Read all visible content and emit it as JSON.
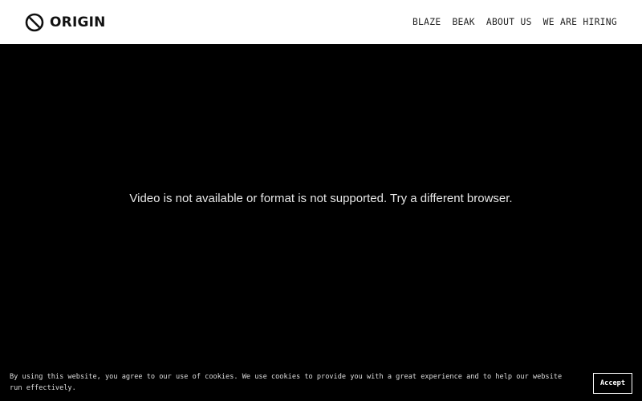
{
  "header": {
    "logo_text": "ORIGIN",
    "logo_icon": "origin-logo-icon",
    "nav": [
      {
        "label": "BLAZE"
      },
      {
        "label": "BEAK"
      },
      {
        "label": "ABOUT US"
      },
      {
        "label": "WE ARE HIRING"
      }
    ]
  },
  "video": {
    "message": "Video is not available or format is not supported. Try a different browser."
  },
  "cookie_banner": {
    "text": "By using this website, you agree to our use of cookies. We use cookies to provide you with a great experience and to help our website run effectively.",
    "accept_label": "Accept"
  },
  "colors": {
    "header_bg": "#ffffff",
    "page_bg": "#000000",
    "logo": "#111111",
    "nav_text": "#222222",
    "message_text": "#e6e6e6"
  }
}
